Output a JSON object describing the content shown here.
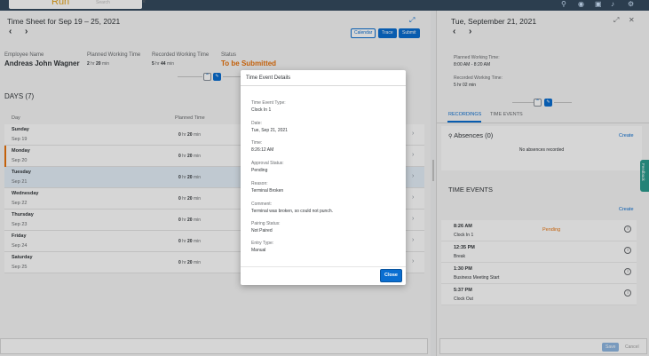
{
  "shell": {
    "logo": "Run",
    "search_placeholder": "Search",
    "close": "×",
    "icons": [
      "search-icon",
      "notifications-icon",
      "user-icon",
      "help-icon"
    ]
  },
  "timesheet": {
    "title": "Time Sheet for Sep 19 – 25, 2021",
    "prev": "‹",
    "next": "›",
    "buttons": {
      "calendar": "Calendar",
      "trace": "Trace",
      "submit": "Submit"
    },
    "header": {
      "employee_label": "Employee Name",
      "employee_name": "Andreas John Wagner",
      "planned_label": "Planned Working Time",
      "planned_hr": "2",
      "planned_min": "20",
      "recorded_label": "Recorded Working Time",
      "recorded_hr": "5",
      "recorded_min": "44",
      "status_label": "Status",
      "status_value": "To be Submitted"
    },
    "days_title": "DAYS (7)",
    "col_day": "Day",
    "col_planned": "Planned Time",
    "hr_unit": "hr",
    "min_unit": "min",
    "days": [
      {
        "name": "Sunday",
        "date": "Sep 19",
        "hr": "0",
        "min": "20"
      },
      {
        "name": "Monday",
        "date": "Sep 20",
        "hr": "0",
        "min": "20"
      },
      {
        "name": "Tuesday",
        "date": "Sep 21",
        "hr": "0",
        "min": "20"
      },
      {
        "name": "Wednesday",
        "date": "Sep 22",
        "hr": "0",
        "min": "20"
      },
      {
        "name": "Thursday",
        "date": "Sep 23",
        "hr": "0",
        "min": "20"
      },
      {
        "name": "Friday",
        "date": "Sep 24",
        "hr": "0",
        "min": "20"
      },
      {
        "name": "Saturday",
        "date": "Sep 25",
        "hr": "0",
        "min": "20"
      }
    ]
  },
  "detail": {
    "title": "Tue, September 21, 2021",
    "planned_label": "Planned Working Time:",
    "planned_value": "8:00 AM - 8:20 AM",
    "recorded_label": "Recorded Working Time:",
    "recorded_value": "5 hr 02 min",
    "tabs": {
      "recordings": "RECORDINGS",
      "time_events": "TIME EVENTS"
    },
    "absences_title": "Absences (0)",
    "absences_create": "Create",
    "absences_empty": "No absences recorded",
    "time_events_title": "TIME EVENTS",
    "time_events_create": "Create",
    "events": [
      {
        "time": "8:26 AM",
        "type": "Clock In 1",
        "status": "Pending"
      },
      {
        "time": "12:35 PM",
        "type": "Break",
        "status": ""
      },
      {
        "time": "1:30 PM",
        "type": "Business Meeting Start",
        "status": ""
      },
      {
        "time": "5:37 PM",
        "type": "Clock Out",
        "status": ""
      }
    ],
    "footer": {
      "save": "Save",
      "cancel": "Cancel"
    },
    "feedback": "Feedback"
  },
  "dialog": {
    "title": "Time Event Details",
    "fields": [
      {
        "label": "Time Event Type:",
        "value": "Clock In 1"
      },
      {
        "label": "Date:",
        "value": "Tue, Sep 21, 2021"
      },
      {
        "label": "Time:",
        "value": "8:26:12 AM"
      },
      {
        "label": "Approval Status:",
        "value": "Pending"
      },
      {
        "label": "Reason:",
        "value": "Terminal Broken"
      },
      {
        "label": "Comment:",
        "value": "Terminal was broken, so could not punch."
      },
      {
        "label": "Pairing Status:",
        "value": "Not Paired"
      },
      {
        "label": "Entry Type:",
        "value": "Manual"
      }
    ],
    "close": "Close"
  }
}
